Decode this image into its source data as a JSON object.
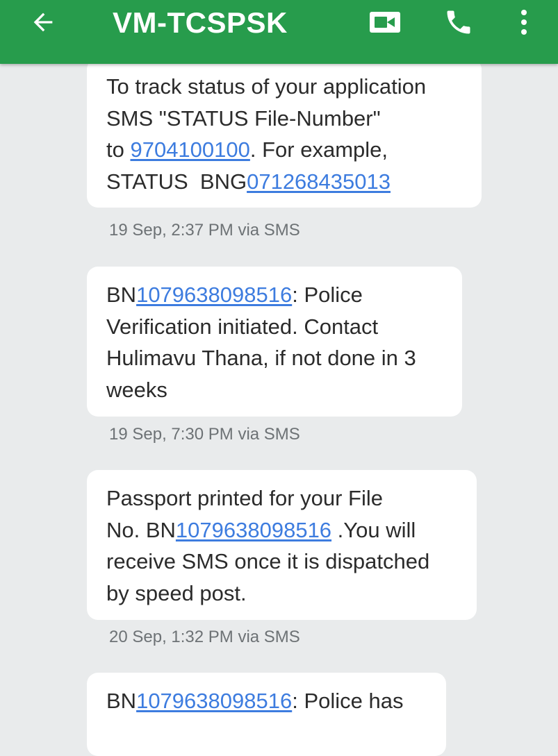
{
  "header": {
    "title": "VM-TCSPSK",
    "bg_color": "#279c4c",
    "icons": [
      "back-arrow-icon",
      "video-call-icon",
      "phone-icon",
      "more-vert-icon"
    ]
  },
  "messages": [
    {
      "lines": [
        [
          {
            "t": "To track status of your application"
          }
        ],
        [
          {
            "t": "SMS \"STATUS File-Number\""
          }
        ],
        [
          {
            "t": "to "
          },
          {
            "t": "9704100100",
            "link": true
          },
          {
            "t": ". For example,"
          }
        ],
        [
          {
            "t": "STATUS  BNG"
          },
          {
            "t": "071268435013",
            "link": true
          }
        ]
      ],
      "meta": "19 Sep, 2:37 PM via SMS"
    },
    {
      "lines": [
        [
          {
            "t": "BN"
          },
          {
            "t": "1079638098516",
            "link": true
          },
          {
            "t": ": Police"
          }
        ],
        [
          {
            "t": "Verification initiated. Contact"
          }
        ],
        [
          {
            "t": "Hulimavu Thana, if not done in 3"
          }
        ],
        [
          {
            "t": "weeks"
          }
        ]
      ],
      "meta": "19 Sep, 7:30 PM via SMS"
    },
    {
      "lines": [
        [
          {
            "t": "Passport printed for your File"
          }
        ],
        [
          {
            "t": "No. BN"
          },
          {
            "t": "1079638098516",
            "link": true
          },
          {
            "t": " .You will"
          }
        ],
        [
          {
            "t": "receive SMS once it is dispatched"
          }
        ],
        [
          {
            "t": "by speed post."
          }
        ]
      ],
      "meta": "20 Sep, 1:32 PM via SMS"
    },
    {
      "lines": [
        [
          {
            "t": "BN"
          },
          {
            "t": "1079638098516",
            "link": true
          },
          {
            "t": ": Police has"
          }
        ]
      ],
      "meta": ""
    }
  ],
  "colors": {
    "link": "#3d7cdf",
    "background": "#e9ebec",
    "bubble": "#ffffff",
    "meta_text": "#6d7275"
  }
}
